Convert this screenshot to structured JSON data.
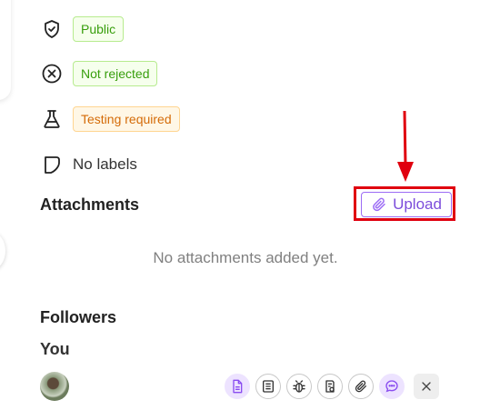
{
  "properties": {
    "visibility": "Public",
    "rejection": "Not rejected",
    "testing": "Testing required",
    "labels": "No labels"
  },
  "attachments": {
    "title": "Attachments",
    "upload_label": "Upload",
    "empty_text": "No attachments added yet."
  },
  "followers": {
    "title": "Followers",
    "you_label": "You"
  },
  "icons": {
    "visibility": "shield-check-icon",
    "rejection": "x-circle-icon",
    "testing": "flask-icon",
    "labels": "label-icon",
    "upload": "paperclip-icon",
    "toolbar": [
      "document-icon",
      "list-icon",
      "bug-icon",
      "clipboard-check-icon",
      "paperclip-icon",
      "chat-icon",
      "close-icon"
    ]
  },
  "colors": {
    "accent": "#7c4ddb",
    "highlight": "#e0000f",
    "tag_green": "#389e0d",
    "tag_orange": "#d46b08"
  }
}
